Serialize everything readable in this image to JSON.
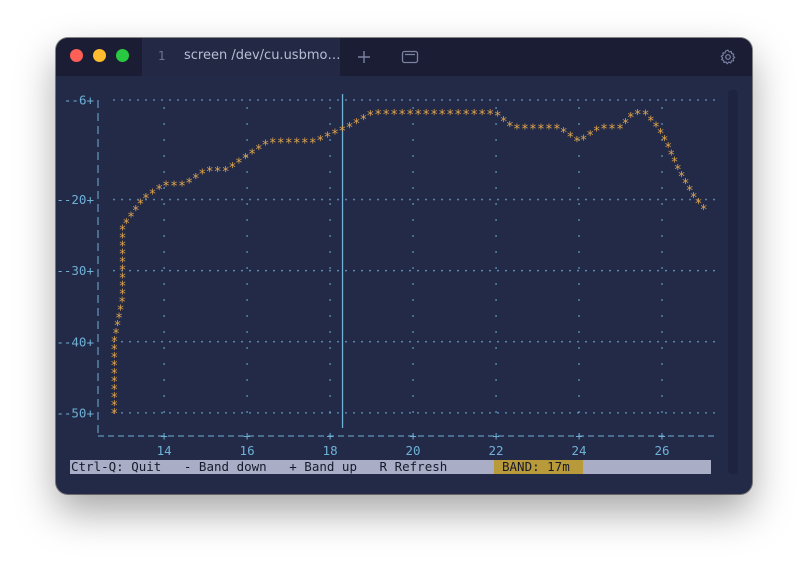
{
  "window": {
    "tab_number": "1",
    "tab_title": "screen /dev/cu.usbmo…"
  },
  "colors": {
    "background": "#222a48",
    "axis": "#6fb0d6",
    "trace": "#e0a64d",
    "status_bar": "#a9adc5",
    "band_highlight": "#b89a3a"
  },
  "chart_data": {
    "type": "line",
    "xlabel": "",
    "ylabel": "",
    "xlim": [
      12.6,
      27.3
    ],
    "ylim": [
      -51,
      -6
    ],
    "x_ticks": [
      "14",
      "16",
      "18",
      "20",
      "22",
      "24",
      "26"
    ],
    "y_ticks": [
      "-6",
      "-20",
      "-30",
      "-40",
      "-50"
    ],
    "marker_line_x": 18.3,
    "series": [
      {
        "x": [
          12.8,
          12.8,
          13.0,
          13.0,
          13.5,
          13.5,
          14.0,
          14.5,
          15.0,
          15.5,
          16.0,
          16.5,
          17.0,
          17.6,
          18.4,
          19.0,
          20.0,
          21.0,
          22.0,
          22.4,
          23.0,
          23.5,
          24.0,
          24.5,
          25.0,
          25.3,
          25.6,
          25.9,
          26.1,
          26.4,
          26.8,
          27.1
        ],
        "y": [
          -50,
          -40,
          -34,
          -24,
          -20,
          -20,
          -18,
          -18,
          -16,
          -16,
          -14,
          -12,
          -12,
          -12,
          -10,
          -8,
          -8,
          -8,
          -8,
          -10,
          -10,
          -10,
          -12,
          -10,
          -10,
          -8,
          -8,
          -10,
          -12,
          -16,
          -20,
          -22
        ]
      }
    ]
  },
  "status_bar": {
    "text": "Ctrl-Q: Quit   - Band down   + Band up   R Refresh",
    "band": "BAND: 17m"
  }
}
